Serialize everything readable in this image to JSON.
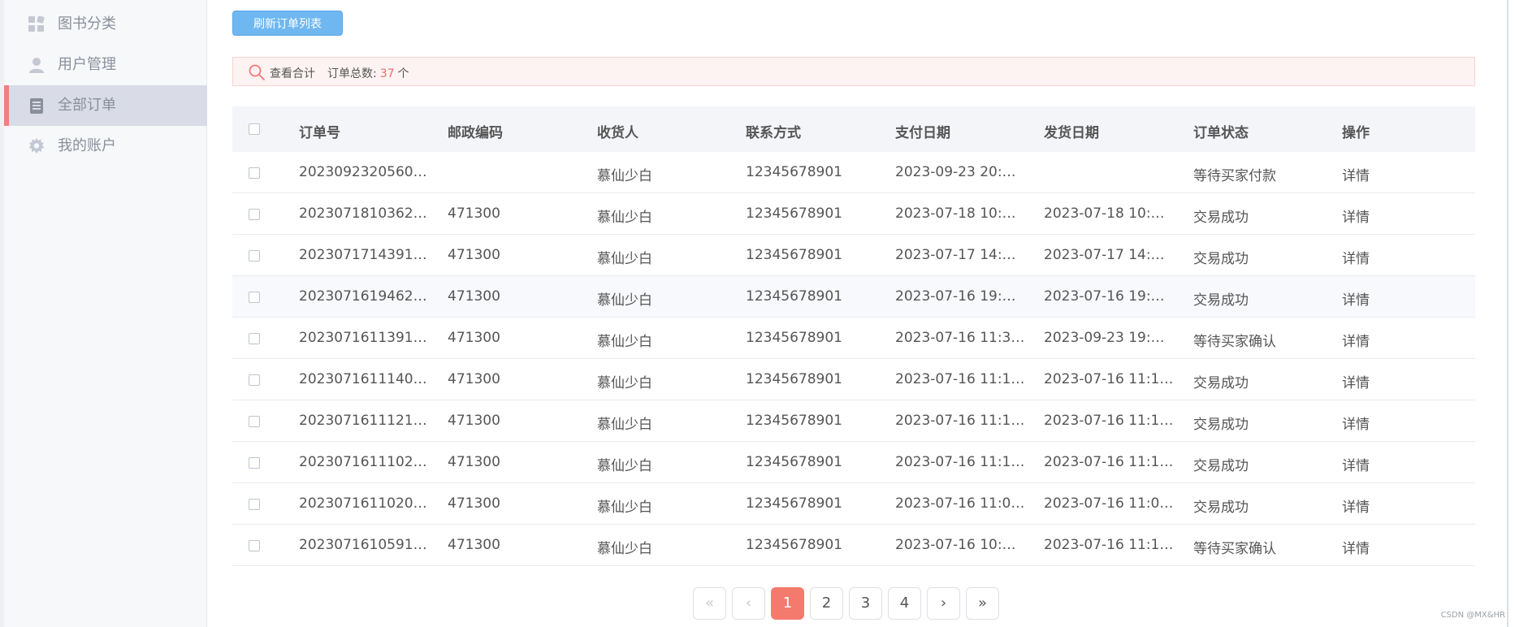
{
  "sidebar": {
    "items": [
      {
        "label": "图书分类",
        "icon": "grid-icon",
        "active": false
      },
      {
        "label": "用户管理",
        "icon": "user-icon",
        "active": false
      },
      {
        "label": "全部订单",
        "icon": "clipboard-icon",
        "active": true
      },
      {
        "label": "我的账户",
        "icon": "gear-icon",
        "active": false
      }
    ]
  },
  "toolbar": {
    "refresh_label": "刷新订单列表"
  },
  "summary": {
    "view_total_label": "查看合计",
    "order_count_label": "订单总数:",
    "order_count": "37",
    "unit": "个"
  },
  "table": {
    "headers": [
      "订单号",
      "邮政编码",
      "收货人",
      "联系方式",
      "支付日期",
      "发货日期",
      "订单状态",
      "操作"
    ],
    "rows": [
      {
        "order": "2023092320560…",
        "zip": "",
        "receiver": "慕仙少白",
        "phone": "12345678901",
        "pay": "2023-09-23 20:…",
        "ship": "",
        "status": "等待买家付款",
        "status_type": "wait-pay",
        "op": "详情"
      },
      {
        "order": "2023071810362…",
        "zip": "471300",
        "receiver": "慕仙少白",
        "phone": "12345678901",
        "pay": "2023-07-18 10:…",
        "ship": "2023-07-18 10:…",
        "status": "交易成功",
        "status_type": "success",
        "op": "详情"
      },
      {
        "order": "2023071714391…",
        "zip": "471300",
        "receiver": "慕仙少白",
        "phone": "12345678901",
        "pay": "2023-07-17 14:…",
        "ship": "2023-07-17 14:…",
        "status": "交易成功",
        "status_type": "success",
        "op": "详情"
      },
      {
        "order": "2023071619462…",
        "zip": "471300",
        "receiver": "慕仙少白",
        "phone": "12345678901",
        "pay": "2023-07-16 19:…",
        "ship": "2023-07-16 19:…",
        "status": "交易成功",
        "status_type": "success",
        "op": "详情"
      },
      {
        "order": "2023071611391…",
        "zip": "471300",
        "receiver": "慕仙少白",
        "phone": "12345678901",
        "pay": "2023-07-16 11:3…",
        "ship": "2023-09-23 19:…",
        "status": "等待买家确认",
        "status_type": "wait-confirm",
        "op": "详情"
      },
      {
        "order": "2023071611140…",
        "zip": "471300",
        "receiver": "慕仙少白",
        "phone": "12345678901",
        "pay": "2023-07-16 11:1…",
        "ship": "2023-07-16 11:1…",
        "status": "交易成功",
        "status_type": "success",
        "op": "详情"
      },
      {
        "order": "2023071611121…",
        "zip": "471300",
        "receiver": "慕仙少白",
        "phone": "12345678901",
        "pay": "2023-07-16 11:1…",
        "ship": "2023-07-16 11:1…",
        "status": "交易成功",
        "status_type": "success",
        "op": "详情"
      },
      {
        "order": "2023071611102…",
        "zip": "471300",
        "receiver": "慕仙少白",
        "phone": "12345678901",
        "pay": "2023-07-16 11:1…",
        "ship": "2023-07-16 11:1…",
        "status": "交易成功",
        "status_type": "success",
        "op": "详情"
      },
      {
        "order": "2023071611020…",
        "zip": "471300",
        "receiver": "慕仙少白",
        "phone": "12345678901",
        "pay": "2023-07-16 11:0…",
        "ship": "2023-07-16 11:0…",
        "status": "交易成功",
        "status_type": "success",
        "op": "详情"
      },
      {
        "order": "2023071610591…",
        "zip": "471300",
        "receiver": "慕仙少白",
        "phone": "12345678901",
        "pay": "2023-07-16 10:…",
        "ship": "2023-07-16 11:1…",
        "status": "等待买家确认",
        "status_type": "wait-confirm",
        "op": "详情"
      }
    ]
  },
  "pagination": {
    "first": "«",
    "prev": "‹",
    "pages": [
      "1",
      "2",
      "3",
      "4"
    ],
    "current": "1",
    "next": "›",
    "last": "»"
  },
  "colors": {
    "accent": "#f47a6e",
    "refresh_button": "#6fb7f0",
    "status_wait_pay": "#d6a86b",
    "status_success": "#74c07a",
    "status_wait_confirm": "#63a9ec"
  },
  "watermark": "CSDN @MX&HR"
}
